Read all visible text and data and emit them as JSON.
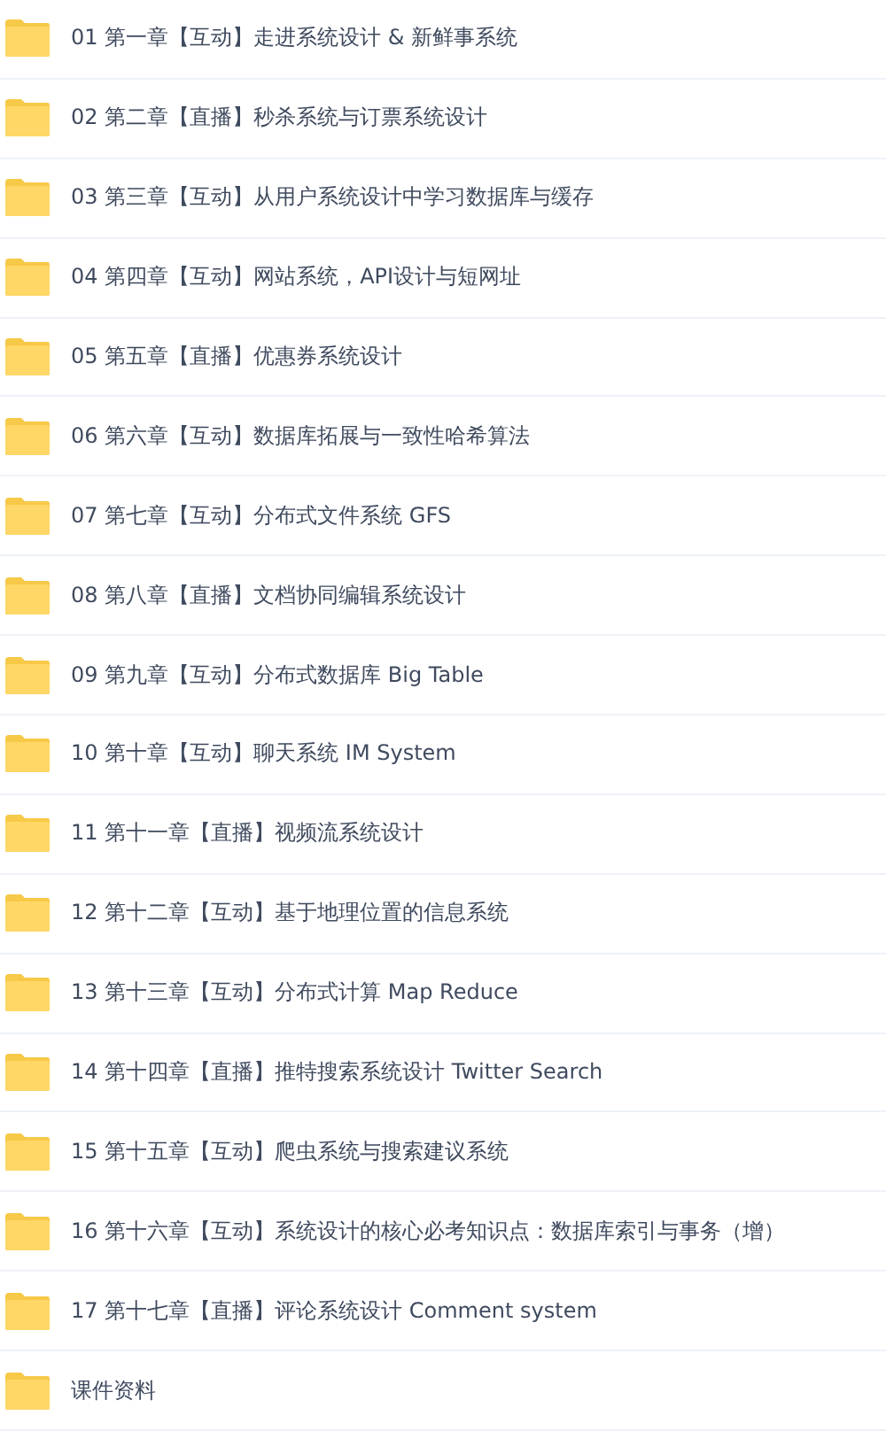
{
  "items": [
    {
      "label": "01 第一章【互动】走进系统设计 & 新鲜事系统"
    },
    {
      "label": "02 第二章【直播】秒杀系统与订票系统设计"
    },
    {
      "label": "03 第三章【互动】从用户系统设计中学习数据库与缓存"
    },
    {
      "label": "04 第四章【互动】网站系统，API设计与短网址"
    },
    {
      "label": "05 第五章【直播】优惠券系统设计"
    },
    {
      "label": "06 第六章【互动】数据库拓展与一致性哈希算法"
    },
    {
      "label": "07 第七章【互动】分布式文件系统 GFS"
    },
    {
      "label": "08 第八章【直播】文档协同编辑系统设计"
    },
    {
      "label": "09 第九章【互动】分布式数据库 Big Table"
    },
    {
      "label": "10 第十章【互动】聊天系统 IM System"
    },
    {
      "label": "11 第十一章【直播】视频流系统设计"
    },
    {
      "label": "12 第十二章【互动】基于地理位置的信息系统"
    },
    {
      "label": "13 第十三章【互动】分布式计算 Map Reduce"
    },
    {
      "label": "14 第十四章【直播】推特搜索系统设计 Twitter Search"
    },
    {
      "label": "15 第十五章【互动】爬虫系统与搜索建议系统"
    },
    {
      "label": "16 第十六章【互动】系统设计的核心必考知识点：数据库索引与事务（增）"
    },
    {
      "label": "17 第十七章【直播】评论系统设计 Comment system"
    },
    {
      "label": "课件资料"
    }
  ]
}
